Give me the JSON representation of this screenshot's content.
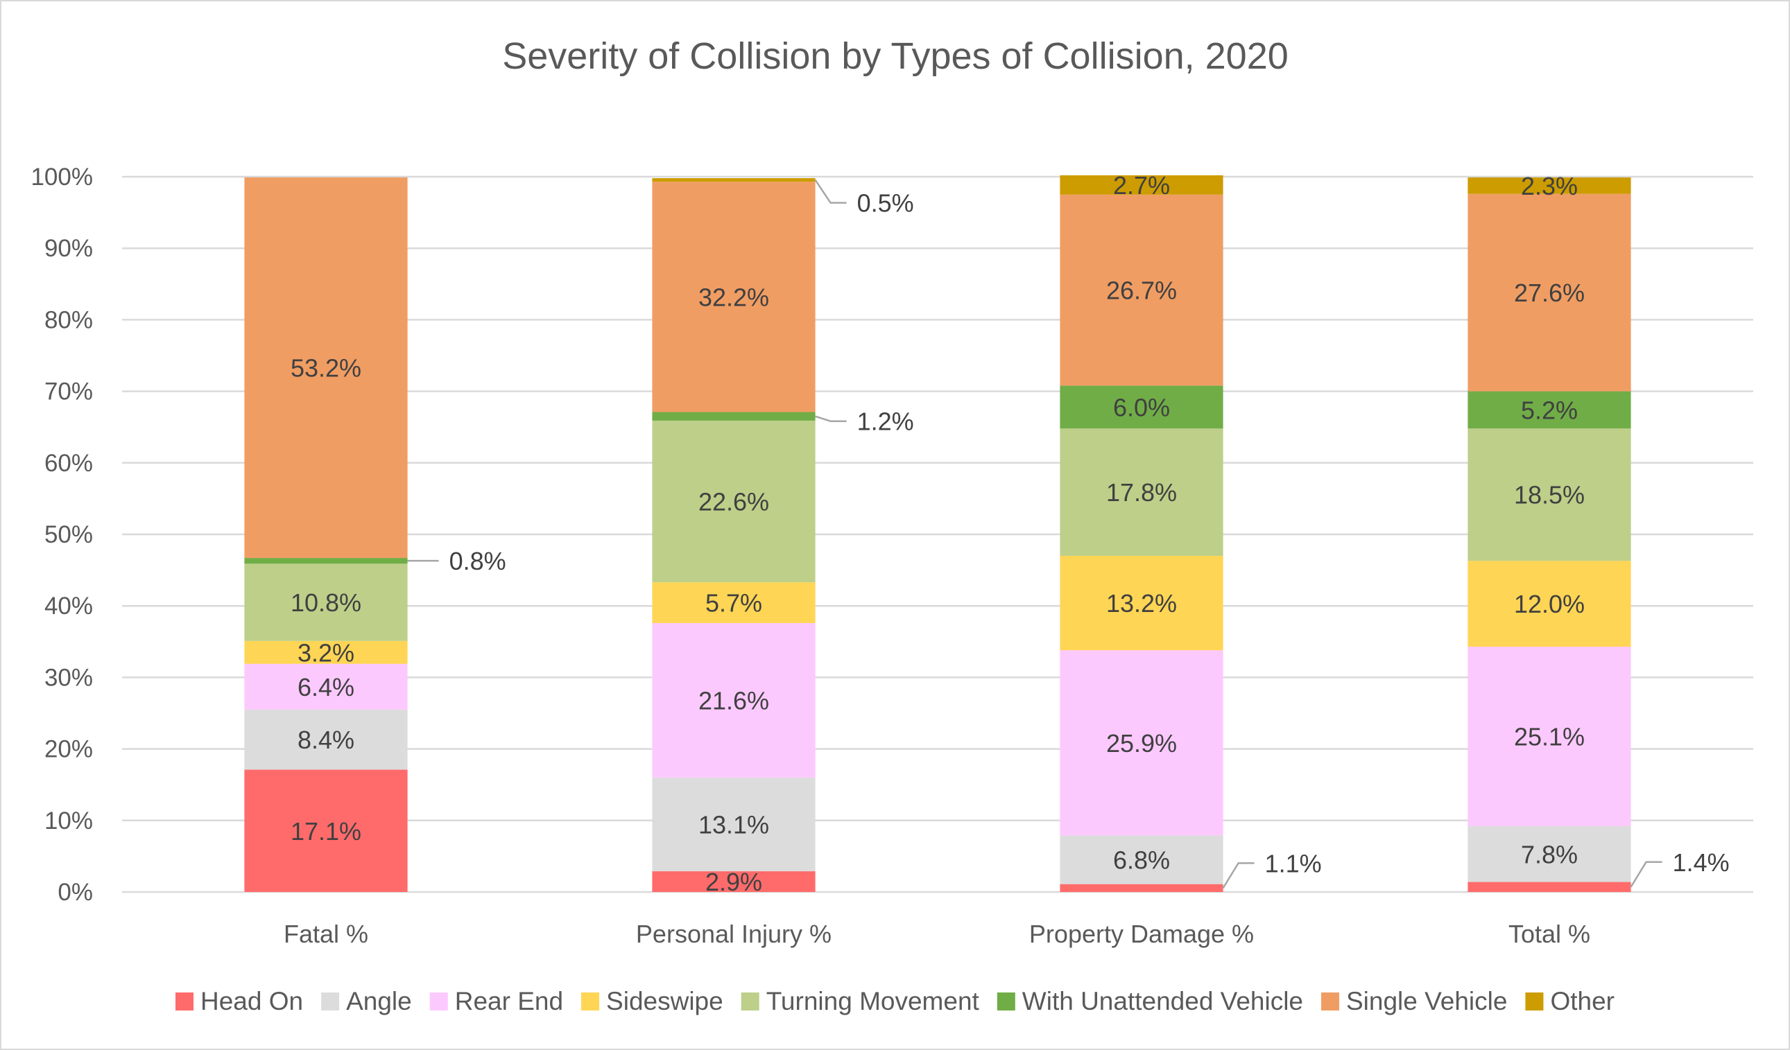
{
  "chart_data": {
    "type": "bar",
    "stacked": true,
    "title": "Severity of Collision by Types of Collision, 2020",
    "xlabel": "",
    "ylabel": "",
    "ylim": [
      0,
      100
    ],
    "yticks": [
      0,
      10,
      20,
      30,
      40,
      50,
      60,
      70,
      80,
      90,
      100
    ],
    "ytick_format": "{v}%",
    "grid": true,
    "legend_position": "bottom",
    "categories": [
      "Fatal %",
      "Personal Injury %",
      "Property Damage %",
      "Total %"
    ],
    "series": [
      {
        "name": "Head On",
        "color": "#ff6b6b",
        "values": [
          17.1,
          2.9,
          1.1,
          1.4
        ],
        "labels": [
          "17.1%",
          "2.9%",
          "1.1%",
          "1.4%"
        ]
      },
      {
        "name": "Angle",
        "color": "#dcdcdc",
        "values": [
          8.4,
          13.1,
          6.8,
          7.8
        ],
        "labels": [
          "8.4%",
          "13.1%",
          "6.8%",
          "7.8%"
        ]
      },
      {
        "name": "Rear End",
        "color": "#fcc9fe",
        "values": [
          6.4,
          21.6,
          25.9,
          25.1
        ],
        "labels": [
          "6.4%",
          "21.6%",
          "25.9%",
          "25.1%"
        ]
      },
      {
        "name": "Sideswipe",
        "color": "#ffd555",
        "values": [
          3.2,
          5.7,
          13.2,
          12.0
        ],
        "labels": [
          "3.2%",
          "5.7%",
          "13.2%",
          "12.0%"
        ]
      },
      {
        "name": "Turning Movement",
        "color": "#bdcf89",
        "values": [
          10.8,
          22.6,
          17.8,
          18.5
        ],
        "labels": [
          "10.8%",
          "22.6%",
          "17.8%",
          "18.5%"
        ]
      },
      {
        "name": "With Unattended Vehicle",
        "color": "#70ad47",
        "values": [
          0.8,
          1.2,
          6.0,
          5.2
        ],
        "labels": [
          "0.8%",
          "1.2%",
          "6.0%",
          "5.2%"
        ]
      },
      {
        "name": "Single Vehicle",
        "color": "#f09d63",
        "values": [
          53.2,
          32.2,
          26.7,
          27.6
        ],
        "labels": [
          "53.2%",
          "32.2%",
          "26.7%",
          "27.6%"
        ]
      },
      {
        "name": "Other",
        "color": "#cc9c00",
        "values": [
          0.0,
          0.5,
          2.7,
          2.3
        ],
        "labels": [
          "",
          "0.5%",
          "2.7%",
          "2.3%"
        ]
      }
    ],
    "callout_labels": [
      {
        "series": "With Unattended Vehicle",
        "category": "Fatal %",
        "text": "0.8%"
      },
      {
        "series": "Other",
        "category": "Personal Injury %",
        "text": "0.5%"
      },
      {
        "series": "With Unattended Vehicle",
        "category": "Personal Injury %",
        "text": "1.2%"
      },
      {
        "series": "Head On",
        "category": "Property Damage %",
        "text": "1.1%"
      },
      {
        "series": "Head On",
        "category": "Total %",
        "text": "1.4%"
      }
    ]
  }
}
